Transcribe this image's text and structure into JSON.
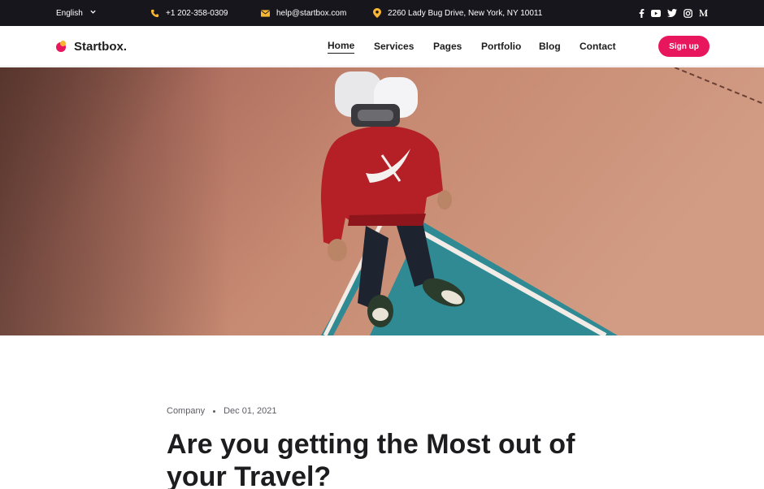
{
  "topbar": {
    "language": "English",
    "phone": "+1 202-358-0309",
    "email": "help@startbox.com",
    "address": "2260 Lady Bug Drive, New York, NY 10011",
    "social": [
      "facebook-icon",
      "youtube-icon",
      "twitter-icon",
      "instagram-icon",
      "medium-icon"
    ]
  },
  "brand": {
    "name": "Startbox.",
    "accent": "#e8175d",
    "secondary": "#f7b733",
    "dark": "#17161c"
  },
  "nav": {
    "items": [
      "Home",
      "Services",
      "Pages",
      "Portfolio",
      "Blog",
      "Contact"
    ],
    "active": "Home",
    "signup_label": "Sign up"
  },
  "article": {
    "category": "Company",
    "date": "Dec 01, 2021",
    "title": "Are you getting the Most out of your Travel?"
  }
}
